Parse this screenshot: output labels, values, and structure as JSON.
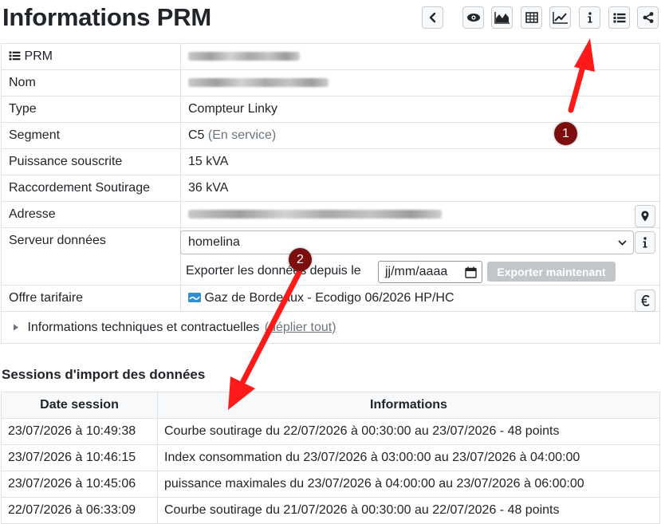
{
  "page": {
    "title": "Informations PRM"
  },
  "toolbar": {
    "buttons": [
      {
        "icon": "chevron-left-icon"
      },
      {
        "icon": "eye-icon"
      },
      {
        "icon": "area-chart-icon"
      },
      {
        "icon": "table-icon"
      },
      {
        "icon": "line-chart-icon"
      },
      {
        "icon": "info-icon"
      },
      {
        "icon": "list-icon"
      },
      {
        "icon": "share-icon"
      }
    ]
  },
  "info": {
    "prm_label": "PRM",
    "nom_label": "Nom",
    "type_label": "Type",
    "type_value": "Compteur Linky",
    "segment_label": "Segment",
    "segment_value": "C5",
    "segment_status": "(En service)",
    "puissance_label": "Puissance souscrite",
    "puissance_value": "15 kVA",
    "raccordement_label": "Raccordement Soutirage",
    "raccordement_value": "36 kVA",
    "adresse_label": "Adresse",
    "serveur_label": "Serveur données",
    "serveur_value": "homelina",
    "export_label": "Exporter les données depuis le",
    "export_date_placeholder": "jj/mm/aaaa",
    "export_button": "Exporter maintenant",
    "offre_label": "Offre tarifaire",
    "offre_value": "Gaz de Bordeaux - Ecodigo 06/2026 HP/HC",
    "details_label": "Informations techniques et contractuelles",
    "details_link": "(déplier tout)"
  },
  "annotations": {
    "marker1": "1",
    "marker2": "2",
    "color": "#ff0000"
  },
  "sessions": {
    "title": "Sessions d'import des données",
    "headers": [
      "Date session",
      "Informations"
    ],
    "rows": [
      {
        "date": "23/07/2026 à 10:49:38",
        "info": "Courbe soutirage du 22/07/2026 à 00:30:00 au 23/07/2026 - 48 points"
      },
      {
        "date": "23/07/2026 à 10:46:15",
        "info": "Index consommation du 23/07/2026 à 03:00:00 au 23/07/2026 à 04:00:00"
      },
      {
        "date": "23/07/2026 à 10:45:06",
        "info": "puissance maximales du 23/07/2026 à 04:00:00 au 23/07/2026 à 06:00:00"
      },
      {
        "date": "22/07/2026 à 06:33:09",
        "info": "Courbe soutirage du 21/07/2026 à 00:30:00 au 22/07/2026 - 48 points"
      }
    ]
  }
}
